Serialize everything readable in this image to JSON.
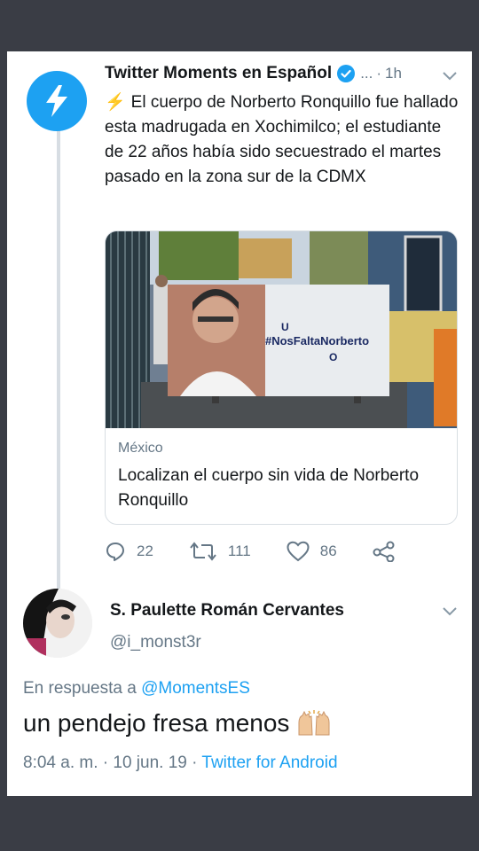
{
  "tweet": {
    "author": "Twitter Moments en Español",
    "ellipsis": "...",
    "separator": "·",
    "time": "1h",
    "text": "El cuerpo de Norberto Ronquillo fue hallado esta madrugada en Xochimilco; el estudiante de 22 años había sido secuestrado el martes pasado en la zona sur de la CDMX",
    "card": {
      "banner_hashtag": "#NosFaltaNorberto",
      "banner_u": "U",
      "banner_o": "O",
      "domain": "México",
      "title": "Localizan el cuerpo sin vida de Norberto Ronquillo"
    },
    "actions": {
      "replies": "22",
      "retweets": "111",
      "likes": "86"
    }
  },
  "reply": {
    "name": "S. Paulette Román Cervantes",
    "handle": "@i_monst3r",
    "in_reply_prefix": "En respuesta a",
    "in_reply_mention": "@MomentsES",
    "text": "un pendejo fresa menos",
    "time": "8:04 a. m.",
    "sep1": "·",
    "date": "10 jun. 19",
    "sep2": "·",
    "app": "Twitter for Android"
  },
  "colors": {
    "twitter_blue": "#1da1f2",
    "text_primary": "#14171a",
    "text_secondary": "#657786",
    "background": "#3a3d45"
  },
  "icons": [
    "bolt-icon",
    "verified-icon",
    "chevron-down-icon",
    "reply-icon",
    "retweet-icon",
    "like-icon",
    "share-icon",
    "raised-hands-emoji"
  ]
}
